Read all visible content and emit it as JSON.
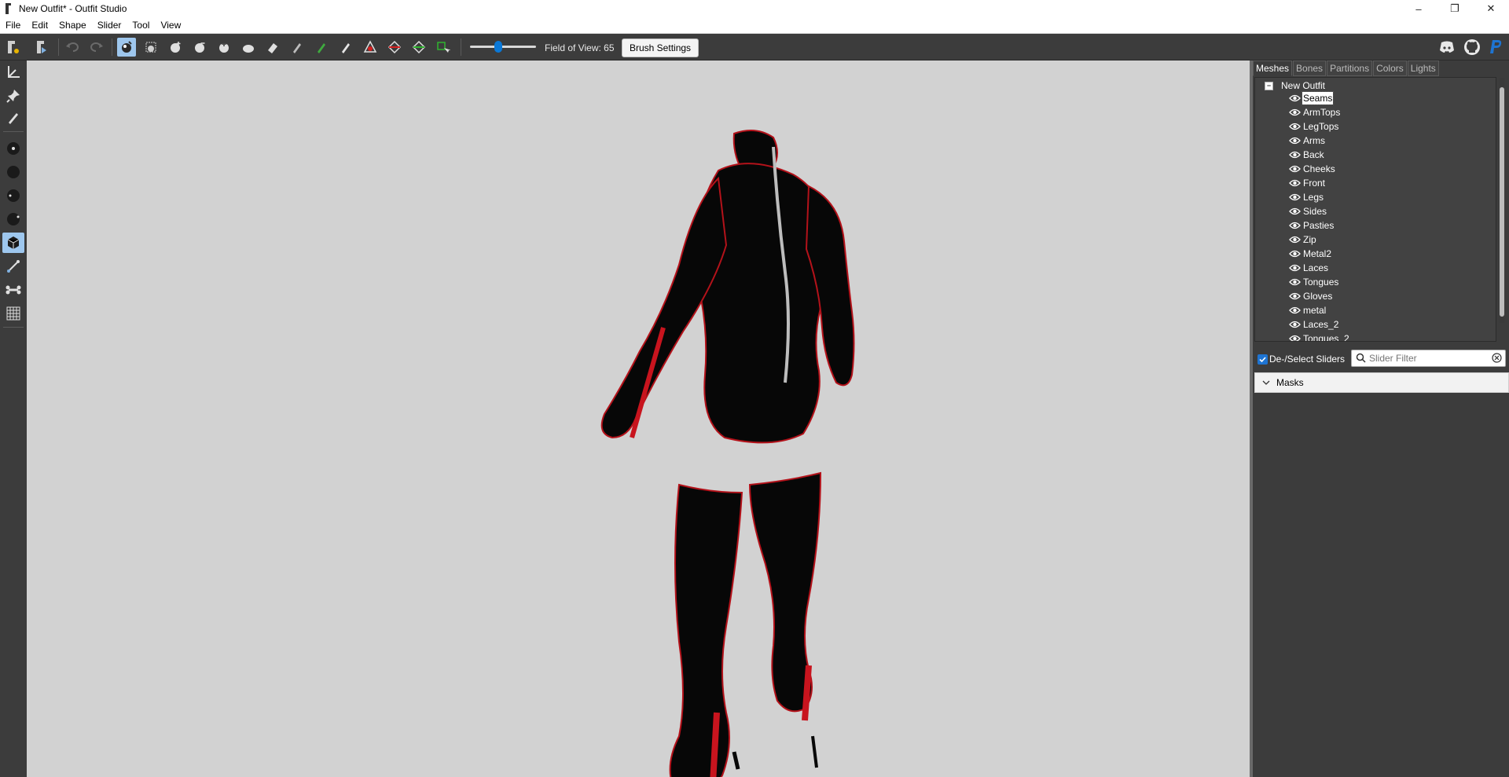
{
  "window": {
    "title": "New Outfit* - Outfit Studio",
    "minimize_glyph": "–",
    "maximize_glyph": "❐",
    "close_glyph": "✕"
  },
  "menu": [
    "File",
    "Edit",
    "Shape",
    "Slider",
    "Tool",
    "View"
  ],
  "toolbar": {
    "fov_label": "Field of View: 65",
    "fov_value": 65,
    "brush_settings_label": "Brush Settings",
    "icons": [
      "new-project-icon",
      "open-project-icon",
      "undo-icon",
      "redo-icon",
      "select-brush-icon",
      "mask-brush-icon",
      "inflate-brush-icon",
      "deflate-brush-icon",
      "move-brush-icon",
      "smooth-brush-icon",
      "eraser-brush-icon",
      "weight-brush-icon",
      "color-brush-icon",
      "alpha-brush-icon",
      "collapse-vertex-icon",
      "flip-edge-icon",
      "split-edge-icon",
      "delete-vertex-icon"
    ],
    "social_icons": [
      "discord-icon",
      "github-icon",
      "paypal-icon"
    ]
  },
  "left_tools": [
    "transform-icon",
    "pivot-icon",
    "brush-icon",
    "vertex-select-icon",
    "vertex-dot-icon",
    "sphere-icon",
    "sphere-light-icon",
    "cube-icon",
    "segment-icon",
    "bone-icon",
    "grid-icon"
  ],
  "right_panel": {
    "tabs": [
      "Meshes",
      "Bones",
      "Partitions",
      "Colors",
      "Lights"
    ],
    "active_tab": "Meshes",
    "root": "New Outfit",
    "meshes": [
      "Seams",
      "ArmTops",
      "LegTops",
      "Arms",
      "Back",
      "Cheeks",
      "Front",
      "Legs",
      "Sides",
      "Pasties",
      "Zip",
      "Metal2",
      "Laces",
      "Tongues",
      "Gloves",
      "metal",
      "Laces_2",
      "Tongues_2"
    ],
    "selected_mesh": "Seams",
    "deselect_label": "De-/Select Sliders",
    "slider_filter_placeholder": "Slider Filter",
    "masks_label": "Masks"
  },
  "colors": {
    "toolbar_bg": "#3c3c3c",
    "viewport_bg": "#d2d2d2",
    "accent_blue": "#1e74d2",
    "suit": "#0a0a0a",
    "trim_red": "#c8141e"
  }
}
